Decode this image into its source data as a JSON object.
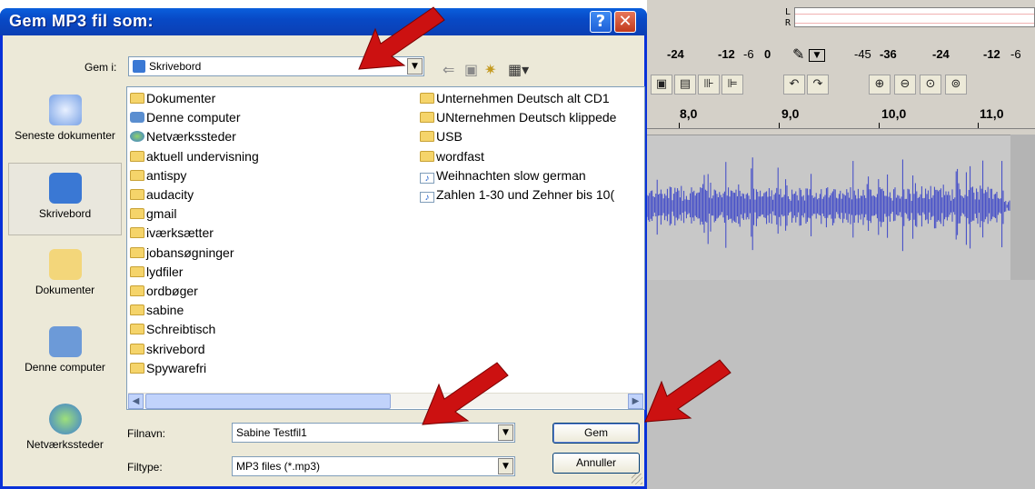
{
  "dialog": {
    "title": "Gem MP3 fil som:",
    "help": "?",
    "close": "✕",
    "save_in_label": "Gem i:",
    "save_in_value": "Skrivebord",
    "filename_label": "Filnavn:",
    "filename_value": "Sabine Testfil1",
    "filetype_label": "Filtype:",
    "filetype_value": "MP3 files (*.mp3)",
    "save_button": "Gem",
    "cancel_button": "Annuller"
  },
  "places": [
    {
      "label": "Seneste dokumenter",
      "icon": "recent-documents-icon"
    },
    {
      "label": "Skrivebord",
      "icon": "desktop-icon"
    },
    {
      "label": "Dokumenter",
      "icon": "documents-icon"
    },
    {
      "label": "Denne computer",
      "icon": "computer-icon"
    },
    {
      "label": "Netværkssteder",
      "icon": "network-icon"
    }
  ],
  "files_col1": [
    {
      "name": "Dokumenter",
      "type": "documents"
    },
    {
      "name": "Denne computer",
      "type": "computer"
    },
    {
      "name": "Netværkssteder",
      "type": "network"
    },
    {
      "name": "aktuell undervisning",
      "type": "folder"
    },
    {
      "name": "antispy",
      "type": "folder"
    },
    {
      "name": "audacity",
      "type": "folder"
    },
    {
      "name": "gmail",
      "type": "folder"
    },
    {
      "name": "iværksætter",
      "type": "folder"
    },
    {
      "name": "jobansøgninger",
      "type": "folder"
    },
    {
      "name": "lydfiler",
      "type": "folder"
    },
    {
      "name": "ordbøger",
      "type": "folder"
    },
    {
      "name": "sabine",
      "type": "folder"
    },
    {
      "name": "Schreibtisch",
      "type": "folder"
    },
    {
      "name": "skrivebord",
      "type": "folder"
    },
    {
      "name": "Spywarefri",
      "type": "folder"
    }
  ],
  "files_col2": [
    {
      "name": "Unternehmen Deutsch alt CD1",
      "type": "folder"
    },
    {
      "name": "UNternehmen Deutsch klippede",
      "type": "folder"
    },
    {
      "name": "USB",
      "type": "folder"
    },
    {
      "name": "wordfast",
      "type": "folder"
    },
    {
      "name": "Weihnachten slow german",
      "type": "audio"
    },
    {
      "name": "Zahlen 1-30 und Zehner bis 10(",
      "type": "audio"
    }
  ],
  "audacity": {
    "meter_l": "L",
    "meter_r": "R",
    "scale": [
      "-24",
      "-12",
      "-6",
      "0",
      "-45",
      "-36",
      "-24",
      "-12",
      "-6"
    ],
    "ruler": [
      "8,0",
      "9,0",
      "10,0",
      "11,0"
    ]
  },
  "colors": {
    "title_bar": "#0a4fcf",
    "arrow_red": "#cc1111",
    "waveform": "#3c46c8"
  }
}
